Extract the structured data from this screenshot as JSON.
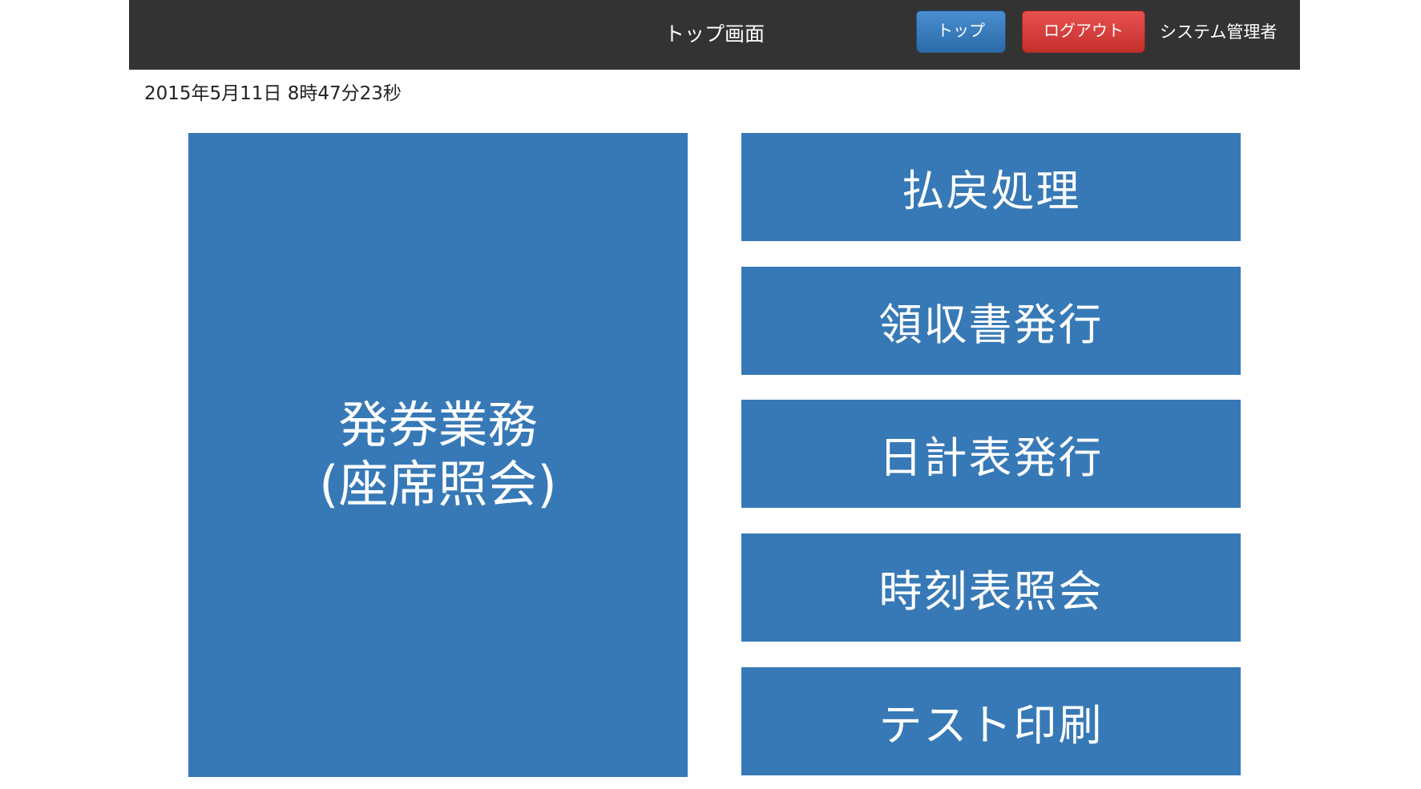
{
  "header": {
    "title": "トップ画面",
    "top_button_label": "トップ",
    "logout_button_label": "ログアウト",
    "user_name": "システム管理者"
  },
  "datetime": "2015年5月11日 8時47分23秒",
  "menu": {
    "main_tile": {
      "line1": "発券業務",
      "line2": "(座席照会)"
    },
    "side_tiles": [
      {
        "label": "払戻処理"
      },
      {
        "label": "領収書発行"
      },
      {
        "label": "日計表発行"
      },
      {
        "label": "時刻表照会"
      },
      {
        "label": "テスト印刷"
      }
    ]
  },
  "colors": {
    "header_bg": "#333333",
    "tile_blue": "#3779b6",
    "top_button_blue": "#2b6aa8",
    "logout_button_red": "#c42f2c"
  }
}
